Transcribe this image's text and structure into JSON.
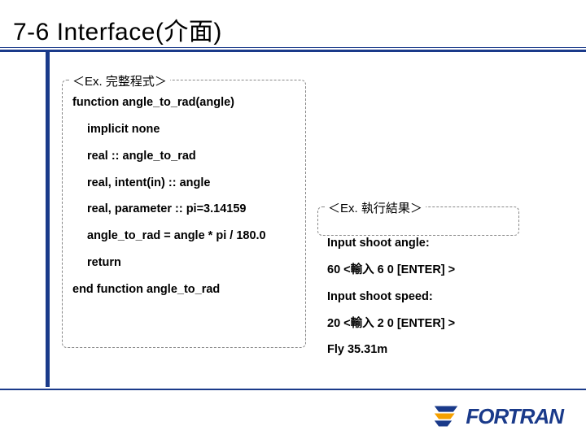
{
  "title": "7-6 Interface(介面)",
  "codebox": {
    "legend": "＜Ex. 完整程式＞",
    "lines": {
      "l0": "function angle_to_rad(angle)",
      "l1": "implicit none",
      "l2": "real :: angle_to_rad",
      "l3": "real, intent(in) :: angle",
      "l4": "real, parameter :: pi=3.14159",
      "l5": "angle_to_rad = angle * pi / 180.0",
      "l6": "return",
      "l7": "end function angle_to_rad"
    }
  },
  "resultbox": {
    "legend": "＜Ex. 執行結果＞",
    "lines": {
      "r0": "Input shoot angle:",
      "r1": "60 <輸入 6 0 [ENTER] >",
      "r2": "Input shoot speed:",
      "r3": "20 <輸入 2 0 [ENTER] >",
      "r4": "Fly  35.31m"
    }
  },
  "logo": "FORTRAN"
}
